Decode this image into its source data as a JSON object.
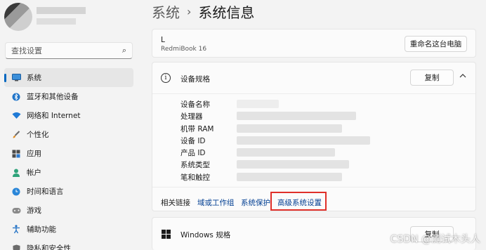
{
  "sidebar": {
    "search_placeholder": "查找设置",
    "items": [
      {
        "label": "系统",
        "icon": "monitor-icon",
        "active": true
      },
      {
        "label": "蓝牙和其他设备",
        "icon": "bluetooth-icon"
      },
      {
        "label": "网络和 Internet",
        "icon": "wifi-icon"
      },
      {
        "label": "个性化",
        "icon": "brush-icon"
      },
      {
        "label": "应用",
        "icon": "apps-icon"
      },
      {
        "label": "帐户",
        "icon": "person-icon"
      },
      {
        "label": "时间和语言",
        "icon": "globe-clock-icon"
      },
      {
        "label": "游戏",
        "icon": "gamepad-icon"
      },
      {
        "label": "辅助功能",
        "icon": "accessibility-icon"
      },
      {
        "label": "隐私和安全性",
        "icon": "shield-icon"
      }
    ]
  },
  "header": {
    "crumb": "系统",
    "separator": "›",
    "title": "系统信息"
  },
  "device_card": {
    "name": "L",
    "model": "RedmiBook 16",
    "rename_button": "重命名这台电脑"
  },
  "spec_card": {
    "title": "设备规格",
    "copy_button": "复制",
    "rows": [
      "设备名称",
      "处理器",
      "机带 RAM",
      "设备 ID",
      "产品 ID",
      "系统类型",
      "笔和触控"
    ]
  },
  "related_links": {
    "label": "相关链接",
    "links": [
      "域或工作组",
      "系统保护",
      "高级系统设置"
    ]
  },
  "windows_card": {
    "title": "Windows 规格",
    "copy_button": "复制"
  },
  "watermark": "CSDN @测试木头人",
  "colors": {
    "accent": "#0067c0",
    "link": "#003e92",
    "highlight_border": "#e0302a"
  }
}
